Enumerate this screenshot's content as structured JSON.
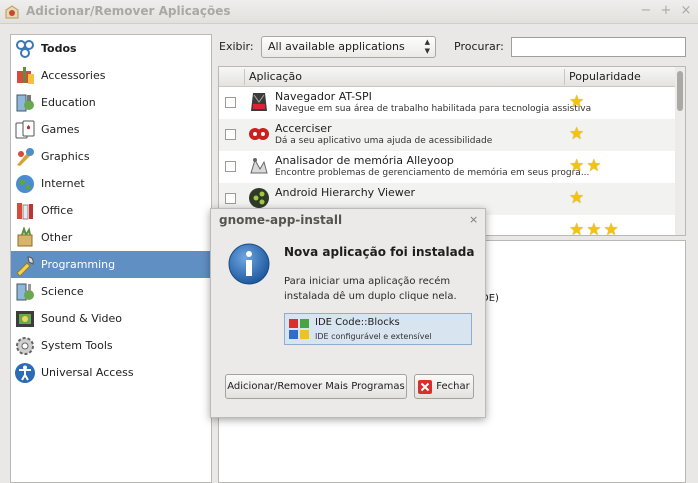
{
  "window": {
    "title": "Adicionar/Remover Aplicações",
    "controls": [
      "−",
      "+",
      "×"
    ]
  },
  "sidebar": {
    "items": [
      {
        "label": "Todos",
        "icon": "all-icon",
        "selected": false
      },
      {
        "label": "Accessories",
        "icon": "accessories-icon",
        "selected": false
      },
      {
        "label": "Education",
        "icon": "education-icon",
        "selected": false
      },
      {
        "label": "Games",
        "icon": "games-icon",
        "selected": false
      },
      {
        "label": "Graphics",
        "icon": "graphics-icon",
        "selected": false
      },
      {
        "label": "Internet",
        "icon": "internet-icon",
        "selected": false
      },
      {
        "label": "Office",
        "icon": "office-icon",
        "selected": false
      },
      {
        "label": "Other",
        "icon": "other-icon",
        "selected": false
      },
      {
        "label": "Programming",
        "icon": "programming-icon",
        "selected": true
      },
      {
        "label": "Science",
        "icon": "science-icon",
        "selected": false
      },
      {
        "label": "Sound & Video",
        "icon": "sound-video-icon",
        "selected": false
      },
      {
        "label": "System Tools",
        "icon": "system-tools-icon",
        "selected": false
      },
      {
        "label": "Universal Access",
        "icon": "universal-access-icon",
        "selected": false
      }
    ]
  },
  "filter": {
    "show_label": "Exibir:",
    "show_value": "All available applications",
    "search_label": "Procurar:",
    "search_value": ""
  },
  "apps": {
    "col_app": "Aplicação",
    "col_pop": "Popularidade",
    "rows": [
      {
        "name": "Navegador AT-SPI",
        "desc": "Navegue em sua área de trabalho habilitada para tecnologia assistiva",
        "stars": "★",
        "icon": "at-spi-browser-icon"
      },
      {
        "name": "Accerciser",
        "desc": "Dá a seu aplicativo uma ajuda de acessibilidade",
        "stars": "★",
        "icon": "accerciser-icon"
      },
      {
        "name": "Analisador de memória Alleyoop",
        "desc": "Encontre problemas de gerenciamento de memória em seus progra...",
        "stars": "★★",
        "icon": "alleyoop-icon"
      },
      {
        "name": "Android Hierarchy Viewer",
        "desc": "",
        "stars": "★",
        "icon": "android-hierarchy-viewer-icon"
      },
      {
        "name": "",
        "desc": "",
        "stars": "★★★",
        "icon": ""
      }
    ]
  },
  "description": {
    "peek_text": "DE)"
  },
  "dialog": {
    "title": "gnome-app-install",
    "close": "×",
    "heading": "Nova aplicação foi instalada",
    "message": "Para iniciar uma aplicação recém instalada dê um duplo clique nela.",
    "app_name": "IDE Code::Blocks",
    "app_desc": "IDE configurável e extensível",
    "btn_more": "Adicionar/Remover Mais Programas",
    "btn_close": "Fechar"
  }
}
